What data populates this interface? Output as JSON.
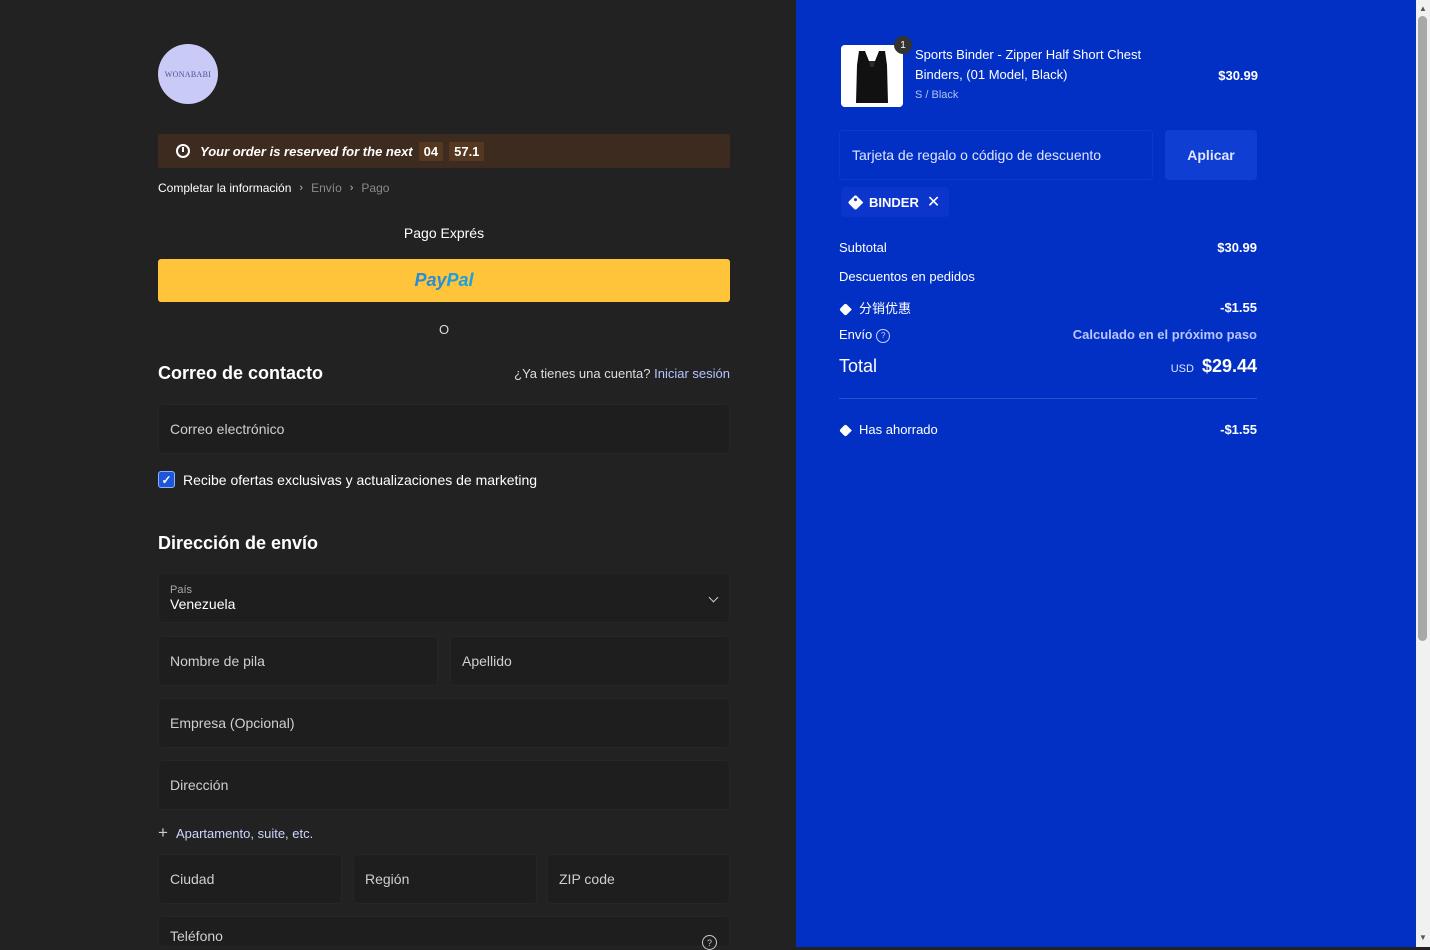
{
  "store": {
    "logo_text": "WONABABI"
  },
  "timer": {
    "message": "Your order is reserved for the next",
    "minutes": "04",
    "seconds": "57.1"
  },
  "breadcrumb": {
    "step1": "Completar la información",
    "step2": "Envío",
    "step3": "Pago"
  },
  "express": {
    "title": "Pago Exprés",
    "paypal_a": "Pay",
    "paypal_b": "Pal",
    "or": "O"
  },
  "contact": {
    "title": "Correo de contacto",
    "have_account": "¿Ya tienes una cuenta?",
    "login": "Iniciar sesión",
    "email_placeholder": "Correo electrónico",
    "marketing_label": "Recibe ofertas exclusivas y actualizaciones de marketing",
    "marketing_checked": true
  },
  "shipping": {
    "title": "Dirección de envío",
    "country_label": "País",
    "country_value": "Venezuela",
    "first_name": "Nombre de pila",
    "last_name": "Apellido",
    "company": "Empresa (Opcional)",
    "address": "Dirección",
    "add_apartment": "Apartamento, suite, etc.",
    "city": "Ciudad",
    "region": "Región",
    "zip": "ZIP code",
    "phone": "Teléfono"
  },
  "cart": {
    "item": {
      "name": "Sports Binder - Zipper Half Short Chest Binders, (01 Model, Black)",
      "variant": "S / Black",
      "price": "$30.99",
      "quantity": "1"
    },
    "gift_placeholder": "Tarjeta de regalo o código de descuento",
    "apply_label": "Aplicar",
    "applied_code": "BINDER",
    "subtotal_label": "Subtotal",
    "subtotal_value": "$30.99",
    "order_discounts_label": "Descuentos en pedidos",
    "discount_name": "分销优惠",
    "discount_value": "-$1.55",
    "shipping_label": "Envío",
    "shipping_value": "Calculado en el próximo paso",
    "total_label": "Total",
    "total_currency": "USD",
    "total_value": "$29.44",
    "saved_label": "Has ahorrado",
    "saved_value": "-$1.55"
  },
  "colors": {
    "left_bg": "#222222",
    "right_bg": "#0230c4",
    "paypal": "#ffc43a",
    "timer_bg": "#3d2b1f"
  }
}
